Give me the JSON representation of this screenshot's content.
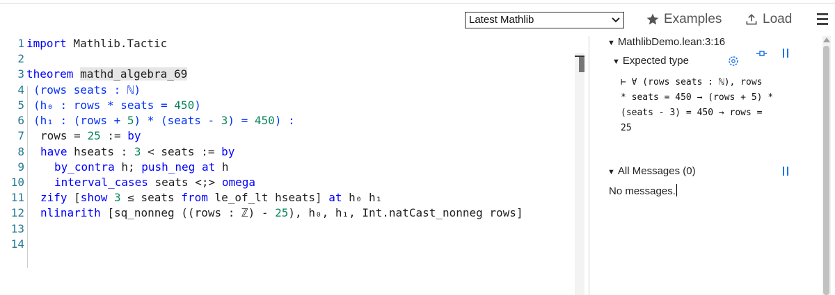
{
  "toolbar": {
    "version_select": "Latest Mathlib",
    "examples_label": "Examples",
    "load_label": "Load"
  },
  "editor": {
    "lines": [
      {
        "n": "1"
      },
      {
        "n": "2"
      },
      {
        "n": "3"
      },
      {
        "n": "4"
      },
      {
        "n": "5"
      },
      {
        "n": "6"
      },
      {
        "n": "7"
      },
      {
        "n": "8"
      },
      {
        "n": "9"
      },
      {
        "n": "10"
      },
      {
        "n": "11"
      },
      {
        "n": "12"
      },
      {
        "n": "13"
      },
      {
        "n": "14"
      }
    ],
    "code": {
      "l1_kw": "import",
      "l1_rest": " Mathlib.Tactic",
      "l3_kw": "theorem",
      "l3_name": "mathd_algebra_69",
      "l4": "(rows seats : ℕ)",
      "l5_a": "(h₀ : rows * seats = ",
      "l5_num": "450",
      "l5_b": ")",
      "l6_a": "(h₁ : (rows + ",
      "l6_n1": "5",
      "l6_b": ") * (seats - ",
      "l6_n2": "3",
      "l6_c": ") = ",
      "l6_n3": "450",
      "l6_d": ") :",
      "l7_a": "rows = ",
      "l7_num": "25",
      "l7_b": " := ",
      "l7_kw": "by",
      "l8_kw": "have",
      "l8_a": " hseats : ",
      "l8_num": "3",
      "l8_b": " < seats := ",
      "l8_kw2": "by",
      "l9_t1": "by_contra",
      "l9_a": " h; ",
      "l9_t2": "push_neg",
      "l9_b": " ",
      "l9_kw": "at",
      "l9_c": " h",
      "l10_t1": "interval_cases",
      "l10_a": " seats <;> ",
      "l10_t2": "omega",
      "l11_t1": "zify",
      "l11_a": " [",
      "l11_kw": "show",
      "l11_b": " ",
      "l11_num": "3",
      "l11_c": " ≤ seats ",
      "l11_kw2": "from",
      "l11_d": " le_of_lt hseats] ",
      "l11_kw3": "at",
      "l11_e": " h₀ h₁",
      "l12_t1": "nlinarith",
      "l12_a": " [sq_nonneg ((rows : ℤ) - ",
      "l12_num": "25",
      "l12_b": "), h₀, h₁, Int.natCast_nonneg rows]"
    }
  },
  "infoview": {
    "file_heading": "MathlibDemo.lean:3:16",
    "expected_type_heading": "Expected type",
    "goal_lines": [
      "⊢ ∀ (rows seats : ℕ), rows",
      "* seats = 450 → (rows + 5) *",
      "(seats - 3) = 450 → rows =",
      "25"
    ],
    "all_messages_heading": "All Messages (0)",
    "no_messages": "No messages."
  },
  "colors": {
    "keyword": "#0000ff",
    "number": "#098658",
    "line_number": "#237893",
    "accent": "#1a73e8"
  }
}
